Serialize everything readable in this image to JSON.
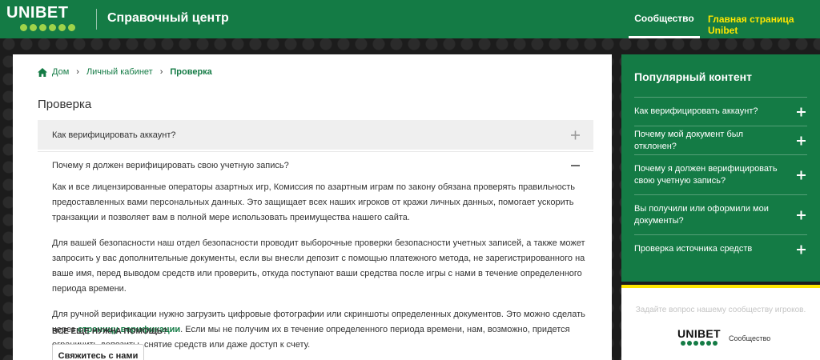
{
  "header": {
    "logo_text": "UNIBET",
    "title": "Справочный центр",
    "nav_community": "Сообщество",
    "nav_home": "Главная страница Unibet"
  },
  "breadcrumb": {
    "home": "Дом",
    "account": "Личный кабинет",
    "current": "Проверка"
  },
  "page": {
    "title": "Проверка"
  },
  "accordion": {
    "item1": {
      "question": "Как верифицировать аккаунт?",
      "state": "collapsed"
    },
    "item2": {
      "question": "Почему я должен верифицировать свою учетную запись?",
      "state": "expanded",
      "p1": "Как и все лицензированные операторы азартных игр, Комиссия по азартным играм по закону обязана проверять правильность предоставленных вами персональных данных. Это защищает всех наших игроков от кражи личных данных, помогает ускорить транзакции и позволяет вам в полной мере использовать преимущества нашего сайта.",
      "p2": "Для вашей безопасности наш отдел безопасности проводит выборочные проверки безопасности учетных записей, а также может запросить у вас дополнительные документы, если вы внесли депозит с помощью платежного метода, не зарегистрированного на ваше имя, перед выводом средств или проверить, откуда поступают ваши средства после игры с нами в течение определенного периода времени.",
      "p3_before": "Для ручной верификации нужно загрузить цифровые фотографии или скриншоты определенных документов. Это можно сделать через ",
      "p3_link": "страницу верификации",
      "p3_after": ". Если мы не получим их в течение определенного периода времени, нам, возможно, придется ограничить депозиты, снятие средств или даже доступ к счету."
    }
  },
  "help": {
    "title": "ВСЕ ЕЩЕ НУЖНА ПОМОЩЬ?",
    "button": "Свяжитесь с нами"
  },
  "sidebar": {
    "title": "Популярный контент",
    "items": [
      {
        "label": "Как верифицировать аккаунт?"
      },
      {
        "label": "Почему мой документ был отклонен?"
      },
      {
        "label": "Почему я должен верифицировать свою учетную запись?"
      },
      {
        "label": "Вы получили или оформили мои документы?"
      },
      {
        "label": "Проверка источника средств"
      }
    ],
    "ask_text": "Задайте вопрос нашему сообществу игроков.",
    "mini_logo_text": "UNIBET",
    "mini_label": "Сообщество"
  },
  "colors": {
    "brand_green": "#147b45",
    "accent_yellow": "#ffe600",
    "logo_dot": "#9fd34a"
  },
  "icons": {
    "home": "home-icon",
    "plus": "plus-icon",
    "minus": "minus-icon",
    "chevron": "chevron-right-icon"
  }
}
